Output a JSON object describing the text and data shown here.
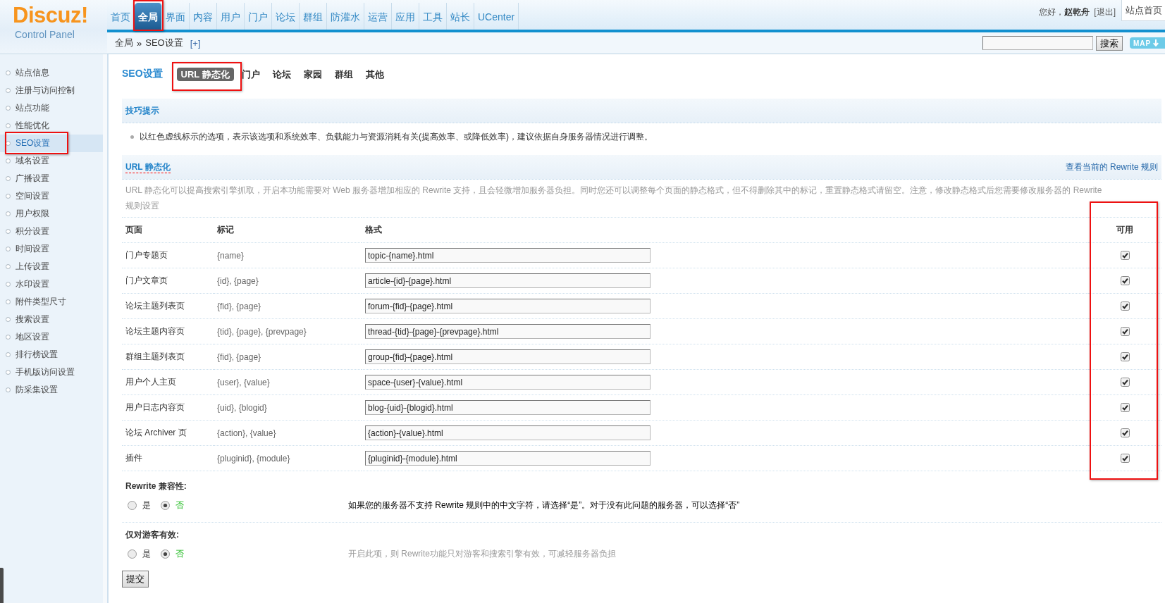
{
  "logo": {
    "name": "Discuz!",
    "subtitle": "Control Panel"
  },
  "nav": [
    {
      "label": "首页",
      "selected": false,
      "annotated": false
    },
    {
      "label": "全局",
      "selected": true,
      "annotated": true
    },
    {
      "label": "界面",
      "selected": false,
      "annotated": false
    },
    {
      "label": "内容",
      "selected": false,
      "annotated": false
    },
    {
      "label": "用户",
      "selected": false,
      "annotated": false
    },
    {
      "label": "门户",
      "selected": false,
      "annotated": false
    },
    {
      "label": "论坛",
      "selected": false,
      "annotated": false
    },
    {
      "label": "群组",
      "selected": false,
      "annotated": false
    },
    {
      "label": "防灌水",
      "selected": false,
      "annotated": false
    },
    {
      "label": "运营",
      "selected": false,
      "annotated": false
    },
    {
      "label": "应用",
      "selected": false,
      "annotated": false
    },
    {
      "label": "工具",
      "selected": false,
      "annotated": false
    },
    {
      "label": "站长",
      "selected": false,
      "annotated": false
    },
    {
      "label": "UCenter",
      "selected": false,
      "annotated": false
    }
  ],
  "user": {
    "greeting": "您好，**赵乾舟**",
    "logout": "[退出]",
    "site_home": "站点首页"
  },
  "breadcrumb": {
    "items": [
      "全局",
      "SEO设置"
    ],
    "separator": "»",
    "expand": "[+]"
  },
  "search": {
    "button": "搜索",
    "map": "MAP"
  },
  "sidebar": {
    "items": [
      {
        "label": "站点信息",
        "selected": false,
        "annotated": false
      },
      {
        "label": "注册与访问控制",
        "selected": false,
        "annotated": false
      },
      {
        "label": "站点功能",
        "selected": false,
        "annotated": false
      },
      {
        "label": "性能优化",
        "selected": false,
        "annotated": false
      },
      {
        "label": "SEO设置",
        "selected": true,
        "annotated": true
      },
      {
        "label": "域名设置",
        "selected": false,
        "annotated": false
      },
      {
        "label": "广播设置",
        "selected": false,
        "annotated": false
      },
      {
        "label": "空间设置",
        "selected": false,
        "annotated": false
      },
      {
        "label": "用户权限",
        "selected": false,
        "annotated": false
      },
      {
        "label": "积分设置",
        "selected": false,
        "annotated": false
      },
      {
        "label": "时间设置",
        "selected": false,
        "annotated": false
      },
      {
        "label": "上传设置",
        "selected": false,
        "annotated": false
      },
      {
        "label": "水印设置",
        "selected": false,
        "annotated": false
      },
      {
        "label": "附件类型尺寸",
        "selected": false,
        "annotated": false
      },
      {
        "label": "搜索设置",
        "selected": false,
        "annotated": false
      },
      {
        "label": "地区设置",
        "selected": false,
        "annotated": false
      },
      {
        "label": "排行榜设置",
        "selected": false,
        "annotated": false
      },
      {
        "label": "手机版访问设置",
        "selected": false,
        "annotated": false
      },
      {
        "label": "防采集设置",
        "selected": false,
        "annotated": false
      }
    ]
  },
  "page": {
    "title": "SEO设置",
    "tabs": [
      {
        "label": "URL 静态化",
        "selected": true,
        "annotated": true
      },
      {
        "label": "门户",
        "selected": false,
        "annotated": false
      },
      {
        "label": "论坛",
        "selected": false,
        "annotated": false
      },
      {
        "label": "家园",
        "selected": false,
        "annotated": false
      },
      {
        "label": "群组",
        "selected": false,
        "annotated": false
      },
      {
        "label": "其他",
        "selected": false,
        "annotated": false
      }
    ]
  },
  "tips": {
    "title": "技巧提示",
    "items": [
      "以红色虚线标示的选项，表示该选项和系统效率、负载能力与资源消耗有关(提高效率、或降低效率)，建议依据自身服务器情况进行调整。"
    ]
  },
  "rewrite": {
    "title": "URL 静态化",
    "performance_marked": true,
    "link": "查看当前的 Rewrite 规则",
    "description": "URL 静态化可以提高搜索引擎抓取，开启本功能需要对 Web 服务器增加相应的 Rewrite 支持，且会轻微增加服务器负担。同时您还可以调整每个页面的静态格式，但不得删除其中的标记，重置静态格式请留空。注意，修改静态格式后您需要修改服务器的 Rewrite 规则设置",
    "columns": [
      {
        "label": "页面",
        "annotated": false
      },
      {
        "label": "标记",
        "annotated": false
      },
      {
        "label": "格式",
        "annotated": false
      },
      {
        "label": "可用",
        "annotated": true
      }
    ],
    "rows": [
      {
        "page": "门户专题页",
        "marks": "{name}",
        "format": "topic-{name}.html",
        "enabled": true
      },
      {
        "page": "门户文章页",
        "marks": "{id}, {page}",
        "format": "article-{id}-{page}.html",
        "enabled": true
      },
      {
        "page": "论坛主题列表页",
        "marks": "{fid}, {page}",
        "format": "forum-{fid}-{page}.html",
        "enabled": true
      },
      {
        "page": "论坛主题内容页",
        "marks": "{tid}, {page}, {prevpage}",
        "format": "thread-{tid}-{page}-{prevpage}.html",
        "enabled": true
      },
      {
        "page": "群组主题列表页",
        "marks": "{fid}, {page}",
        "format": "group-{fid}-{page}.html",
        "enabled": true
      },
      {
        "page": "用户个人主页",
        "marks": "{user}, {value}",
        "format": "space-{user}-{value}.html",
        "enabled": true
      },
      {
        "page": "用户日志内容页",
        "marks": "{uid}, {blogid}",
        "format": "blog-{uid}-{blogid}.html",
        "enabled": true
      },
      {
        "page": "论坛 Archiver 页",
        "marks": "{action}, {value}",
        "format": "{action}-{value}.html",
        "enabled": true
      },
      {
        "page": "插件",
        "marks": "{pluginid}, {module}",
        "format": "{pluginid}-{module}.html",
        "enabled": true
      }
    ]
  },
  "settings": [
    {
      "label": "Rewrite 兼容性:",
      "options": [
        {
          "label": "是",
          "selected": false
        },
        {
          "label": "否",
          "selected": true
        }
      ],
      "tip": "如果您的服务器不支持 Rewrite 规则中的中文字符，请选择“是”。对于没有此问题的服务器，可以选择“否”",
      "hovered": true
    },
    {
      "label": "仅对游客有效:",
      "options": [
        {
          "label": "是",
          "selected": false
        },
        {
          "label": "否",
          "selected": true
        }
      ],
      "tip": "开启此项，则 Rewrite功能只对游客和搜索引擎有效，可减轻服务器负担",
      "hovered": false
    }
  ],
  "submit": "提交"
}
